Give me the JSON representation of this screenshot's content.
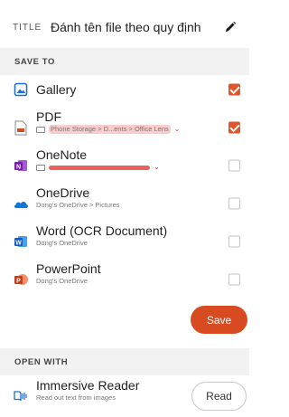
{
  "header": {
    "title_label": "TITLE",
    "title_value": "Đánh tên file theo quy định",
    "edit_icon": "pencil-icon"
  },
  "save_to": {
    "heading": "SAVE TO",
    "destinations": [
      {
        "name": "Gallery",
        "subtitle": "",
        "checked": true,
        "icon": "gallery-icon"
      },
      {
        "name": "PDF",
        "subtitle": "Phone Storage > D...ents > Office Lens",
        "checked": true,
        "icon": "pdf-icon"
      },
      {
        "name": "OneNote",
        "subtitle": "",
        "checked": false,
        "icon": "onenote-icon"
      },
      {
        "name": "OneDrive",
        "subtitle": "Dong's OneDrive > Pictures",
        "checked": false,
        "icon": "onedrive-icon"
      },
      {
        "name": "Word (OCR Document)",
        "subtitle": "Dong's OneDrive",
        "checked": false,
        "icon": "word-icon"
      },
      {
        "name": "PowerPoint",
        "subtitle": "Dong's OneDrive",
        "checked": false,
        "icon": "powerpoint-icon"
      }
    ],
    "save_label": "Save"
  },
  "open_with": {
    "heading": "OPEN WITH",
    "app_name": "Immersive Reader",
    "app_subtitle": "Read out text from images",
    "read_label": "Read"
  },
  "colors": {
    "accent": "#d84a20",
    "checkbox_on": "#e0542a"
  }
}
